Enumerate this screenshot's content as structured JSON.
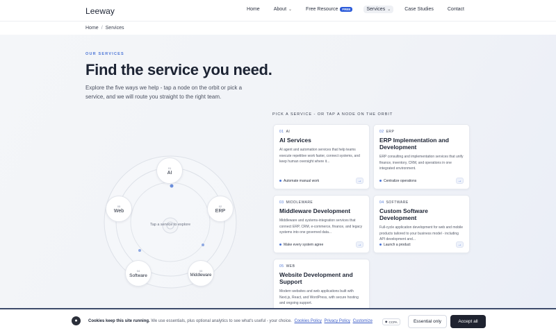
{
  "header": {
    "logo": "Leeway",
    "nav": [
      {
        "label": "Home",
        "has_chevron": false
      },
      {
        "label": "About",
        "has_chevron": true
      },
      {
        "label": "Free Resource",
        "badge": "FREE",
        "has_chevron": false
      },
      {
        "label": "Services",
        "has_chevron": true,
        "active": true
      },
      {
        "label": "Case Studies",
        "has_chevron": false
      },
      {
        "label": "Contact",
        "has_chevron": false
      }
    ]
  },
  "breadcrumb": {
    "home": "Home",
    "separator": "/",
    "current": "Services"
  },
  "hero": {
    "eyebrow": "OUR SERVICES",
    "title": "Find the service you need.",
    "subtitle": "Explore the five ways we help - tap a node on the orbit or pick a service, and we will route you straight to the right team."
  },
  "orbit": {
    "center_hint": "Tap a service to explore",
    "nodes": [
      {
        "num": "01",
        "label": "AI"
      },
      {
        "num": "02",
        "label": "ERP"
      },
      {
        "num": "03",
        "label": "Middleware"
      },
      {
        "num": "04",
        "label": "Software"
      },
      {
        "num": "05",
        "label": "Web"
      }
    ]
  },
  "picker": {
    "label": "PICK A SERVICE - OR TAP A NODE ON THE ORBIT",
    "cards": [
      {
        "num": "01",
        "tag": "AI",
        "title": "AI Services",
        "desc": "AI agent and automation services that help teams execute repetitive work faster, connect systems, and keep human oversight where it...",
        "tagline": "Automate manual work"
      },
      {
        "num": "02",
        "tag": "ERP",
        "title": "ERP Implementation and Development",
        "desc": "ERP consulting and implementation services that unify finance, inventory, CRM, and operations in one integrated environment.",
        "tagline": "Centralize operations"
      },
      {
        "num": "03",
        "tag": "MIDDLEWARE",
        "title": "Middleware Development",
        "desc": "Middleware and systems-integration services that connect ERP, CRM, e-commerce, finance, and legacy systems into one governed data...",
        "tagline": "Make every system agree"
      },
      {
        "num": "04",
        "tag": "SOFTWARE",
        "title": "Custom Software Development",
        "desc": "Full-cycle application development for web and mobile products tailored to your business model - including API development and...",
        "tagline": "Launch a product"
      },
      {
        "num": "05",
        "tag": "WEB",
        "title": "Website Development and Support",
        "desc": "Modern websites and web applications built with Next.js, React, and WordPress, with secure hosting and ongoing support.",
        "tagline": ""
      }
    ],
    "arrow": "→"
  },
  "cookie": {
    "icon": "cookie-icon",
    "bold": "Cookies keep this site running.",
    "text": "We use essentials, plus optional analytics to see what's useful - your choice.",
    "links": [
      "Cookies Policy",
      "Privacy Policy",
      "Customize"
    ],
    "ccpa": "CCPA",
    "essential": "Essential only",
    "accept": "Accept all"
  },
  "colors": {
    "accent": "#4a74d6",
    "dark": "#1f2330",
    "badge": "#2c5bd9"
  }
}
